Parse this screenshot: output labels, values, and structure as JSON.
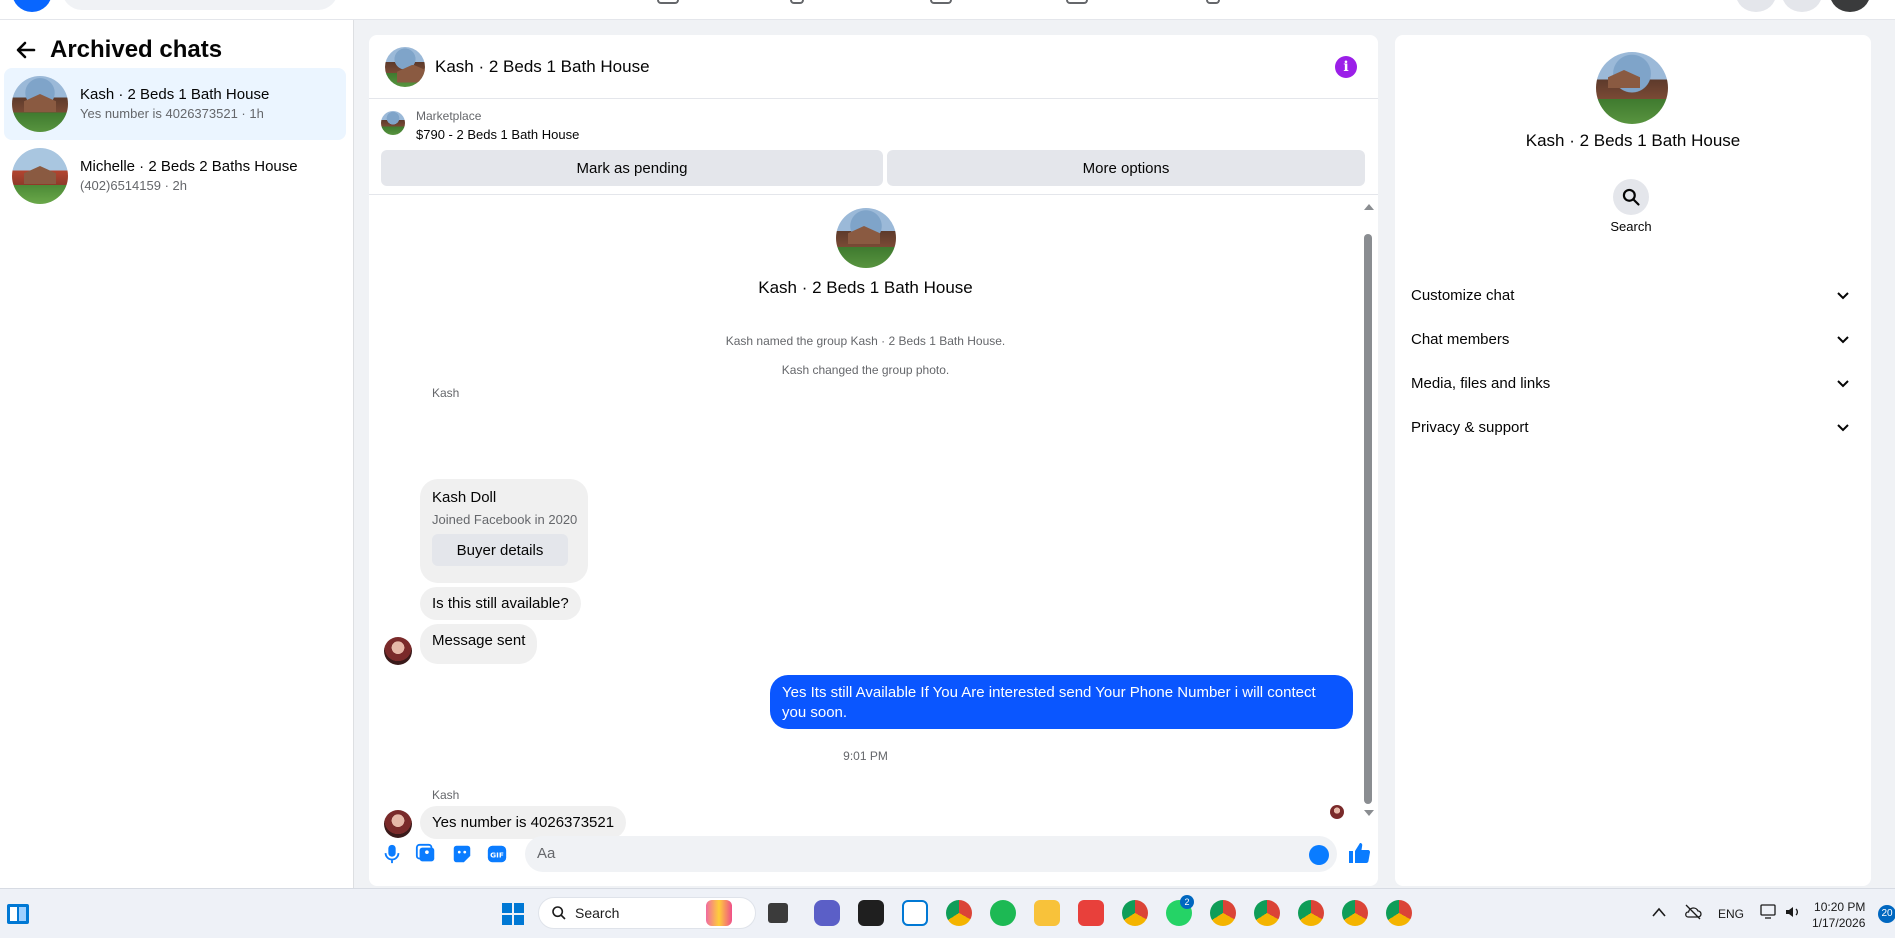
{
  "sidebar": {
    "title": "Archived chats",
    "chats": [
      {
        "name": "Kash · 2 Beds 1 Bath House",
        "preview": "Yes number is 4026373521 · 1h"
      },
      {
        "name": "Michelle · 2 Beds 2 Baths House",
        "preview": "(402)6514159 · 2h"
      }
    ]
  },
  "chat": {
    "title": "Kash · 2 Beds 1 Bath House",
    "marketplace": {
      "label": "Marketplace",
      "listing": "$790 - 2 Beds 1 Bath House"
    },
    "buttons": {
      "pending": "Mark as pending",
      "more": "More options"
    },
    "group_name": "Kash · 2 Beds 1 Bath House",
    "system_messages": [
      "Kash named the group Kash · 2 Beds 1 Bath House.",
      "Kash changed the group photo."
    ],
    "sender": "Kash",
    "card": {
      "name": "Kash Doll",
      "subtitle": "Joined Facebook in 2020",
      "button": "Buyer details"
    },
    "messages_in_1": [
      "Is this still available?",
      "Message sent"
    ],
    "message_out": "Yes Its still Available If You Are interested send Your Phone Number i will contect you soon.",
    "timestamp": "9:01 PM",
    "message_in_2": "Yes number is 4026373521",
    "composer_placeholder": "Aa"
  },
  "info": {
    "name": "Kash · 2 Beds 1 Bath House",
    "search_label": "Search",
    "sections": [
      "Customize chat",
      "Chat members",
      "Media, files and links",
      "Privacy & support"
    ]
  },
  "taskbar": {
    "search": "Search",
    "lang": "ENG",
    "time": "10:20 PM",
    "date": "1/17/2026",
    "notif_count": "20",
    "whatsapp_badge": "2"
  },
  "colors": {
    "brand_blue": "#0866ff",
    "outgoing_bubble": "#0a56ff",
    "info_icon": "#9b1fe8",
    "active_chat_bg": "#ebf5ff"
  }
}
